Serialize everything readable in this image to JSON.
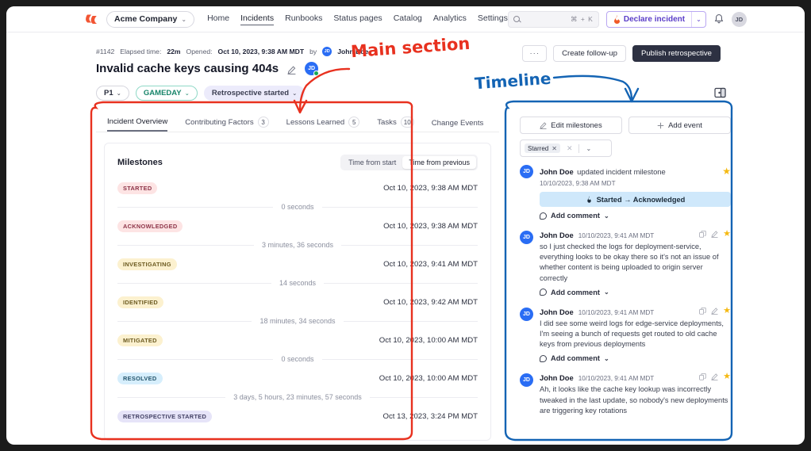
{
  "topnav": {
    "logo": "incident-io-logo",
    "org": {
      "name": "Acme Company",
      "chevron": "⌄"
    },
    "links": [
      {
        "label": "Home",
        "active": false
      },
      {
        "label": "Incidents",
        "active": true
      },
      {
        "label": "Runbooks",
        "active": false
      },
      {
        "label": "Status pages",
        "active": false
      },
      {
        "label": "Catalog",
        "active": false
      },
      {
        "label": "Analytics",
        "active": false
      },
      {
        "label": "Settings",
        "active": false
      }
    ],
    "search": {
      "placeholder": "",
      "shortcut": "⌘ + K"
    },
    "declare": {
      "label": "Declare incident",
      "chevron": "⌄"
    },
    "avatar": "JD"
  },
  "incident": {
    "ref": "#1142",
    "elapsed_label": "Elapsed time:",
    "elapsed_value": "22m",
    "opened_label": "Opened:",
    "opened_value": "Oct 10, 2023, 9:38 AM MDT",
    "by_label": "by",
    "reporter_initials": "JD",
    "reporter": "John Doe",
    "title": "Invalid cache keys causing 404s",
    "lead_initials": "JD",
    "chips": [
      {
        "label": "P1",
        "chevron": "⌄",
        "kind": "priority"
      },
      {
        "label": "GAMEDAY",
        "chevron": "⌄",
        "kind": "mode"
      },
      {
        "label": "Retrospective started",
        "chevron": "⌄",
        "kind": "status"
      }
    ],
    "actions": {
      "more": "···",
      "create_follow_up": "Create follow-up",
      "publish": "Publish retrospective"
    }
  },
  "tabs": [
    {
      "label": "Incident Overview",
      "count": null,
      "active": true
    },
    {
      "label": "Contributing Factors",
      "count": "3",
      "active": false
    },
    {
      "label": "Lessons Learned",
      "count": "5",
      "active": false
    },
    {
      "label": "Tasks",
      "count": "10",
      "active": false
    },
    {
      "label": "Change Events",
      "count": null,
      "active": false
    }
  ],
  "milestones_card": {
    "title": "Milestones",
    "toggle": [
      {
        "label": "Time from start",
        "selected": false
      },
      {
        "label": "Time from previous",
        "selected": true
      }
    ],
    "rows": [
      {
        "tag": "STARTED",
        "color_bg": "#fde4e4",
        "color_fg": "#8d3448",
        "time": "Oct 10, 2023, 9:38 AM MDT"
      },
      {
        "gap": "0 seconds"
      },
      {
        "tag": "ACKNOWLEDGED",
        "color_bg": "#fde4e4",
        "color_fg": "#8d3448",
        "time": "Oct 10, 2023, 9:38 AM MDT"
      },
      {
        "gap": "3 minutes, 36 seconds"
      },
      {
        "tag": "INVESTIGATING",
        "color_bg": "#fcf1cf",
        "color_fg": "#6b5a20",
        "time": "Oct 10, 2023, 9:41 AM MDT"
      },
      {
        "gap": "14 seconds"
      },
      {
        "tag": "IDENTIFIED",
        "color_bg": "#fcf1cf",
        "color_fg": "#6b5a20",
        "time": "Oct 10, 2023, 9:42 AM MDT"
      },
      {
        "gap": "18 minutes, 34 seconds"
      },
      {
        "tag": "MITIGATED",
        "color_bg": "#fcf1cf",
        "color_fg": "#6b5a20",
        "time": "Oct 10, 2023, 10:00 AM MDT"
      },
      {
        "gap": "0 seconds"
      },
      {
        "tag": "RESOLVED",
        "color_bg": "#d6eefc",
        "color_fg": "#25566d",
        "time": "Oct 10, 2023, 10:00 AM MDT"
      },
      {
        "gap": "3 days, 5 hours, 23 minutes, 57 seconds"
      },
      {
        "tag": "RETROSPECTIVE STARTED",
        "color_bg": "#e6e4f8",
        "color_fg": "#413f63",
        "time": "Oct 13, 2023, 3:24 PM MDT"
      }
    ]
  },
  "timeline": {
    "edit_milestones": "Edit milestones",
    "add_event": "Add event",
    "filter_chip": "Starred",
    "filter_chip_x": "✕",
    "filter_clear": "✕",
    "filter_chevron": "⌄",
    "add_comment_label": "Add comment",
    "add_comment_chevron": "⌄",
    "items": [
      {
        "initials": "JD",
        "name": "John Doe",
        "action": "updated incident milestone",
        "timestamp": "10/10/2023, 9:38 AM MDT",
        "timestamp_below": true,
        "starred": true,
        "has_copy_icon": false,
        "has_edit_icon": false,
        "milestone_banner": "Started → Acknowledged",
        "text": null
      },
      {
        "initials": "JD",
        "name": "John Doe",
        "action": null,
        "timestamp": "10/10/2023, 9:41 AM MDT",
        "timestamp_below": false,
        "starred": true,
        "has_copy_icon": true,
        "has_edit_icon": true,
        "milestone_banner": null,
        "text": "so I just checked the logs for deployment-service, everything looks to be okay there so it's not an issue of whether content is being uploaded to origin server correctly"
      },
      {
        "initials": "JD",
        "name": "John Doe",
        "action": null,
        "timestamp": "10/10/2023, 9:41 AM MDT",
        "timestamp_below": false,
        "starred": true,
        "has_copy_icon": true,
        "has_edit_icon": true,
        "milestone_banner": null,
        "text": "I did see some weird logs for edge-service deployments, I'm seeing a bunch of requests get routed to old cache keys from previous deployments"
      },
      {
        "initials": "JD",
        "name": "John Doe",
        "action": null,
        "timestamp": "10/10/2023, 9:41 AM MDT",
        "timestamp_below": false,
        "starred": true,
        "has_copy_icon": true,
        "has_edit_icon": true,
        "milestone_banner": null,
        "text": "Ah, it looks like the cache key lookup was incorrectly tweaked in the last update, so nobody's new deployments are triggering key rotations"
      }
    ]
  },
  "annotations": [
    {
      "text": "Main section",
      "color": "#e8311f"
    },
    {
      "text": "Timeline",
      "color": "#1464b4"
    }
  ]
}
